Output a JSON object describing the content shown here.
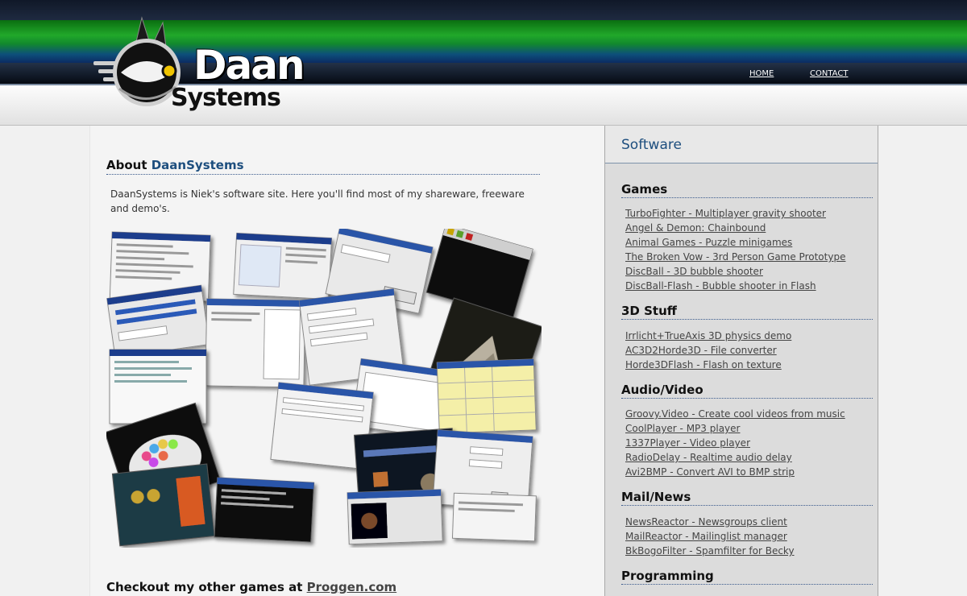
{
  "header": {
    "logo_text_1": "Daan",
    "logo_text_2": "Systems",
    "nav": {
      "home": "HOME",
      "contact": "CONTACT"
    }
  },
  "main": {
    "about_prefix": "About ",
    "about_accent": "DaanSystems",
    "intro": "DaanSystems is Niek's software site. Here you'll find most of my shareware, freeware and demo's.",
    "checkout_prefix": "Checkout my other games at ",
    "checkout_link": "Proggen.com"
  },
  "sidebar": {
    "title": "Software",
    "categories": [
      {
        "title": "Games",
        "links": [
          "TurboFighter - Multiplayer gravity shooter",
          "Angel & Demon: Chainbound",
          "Animal Games - Puzzle minigames",
          "The Broken Vow - 3rd Person Game Prototype",
          "DiscBall - 3D bubble shooter",
          "DiscBall-Flash - Bubble shooter in Flash"
        ]
      },
      {
        "title": "3D Stuff",
        "links": [
          "Irrlicht+TrueAxis 3D physics demo",
          "AC3D2Horde3D - File converter",
          "Horde3DFlash - Flash on texture"
        ]
      },
      {
        "title": "Audio/Video",
        "links": [
          "Groovy.Video - Create cool videos from music",
          "CoolPlayer - MP3 player",
          "1337Player - Video player",
          "RadioDelay - Realtime audio delay",
          "Avi2BMP - Convert AVI to BMP strip"
        ]
      },
      {
        "title": "Mail/News",
        "links": [
          "NewsReactor - Newsgroups client",
          "MailReactor - Mailinglist manager",
          "BkBogoFilter - Spamfilter for Becky"
        ]
      },
      {
        "title": "Programming",
        "links": []
      }
    ]
  },
  "icons": {
    "logo": "eye-orb-logo-icon"
  }
}
